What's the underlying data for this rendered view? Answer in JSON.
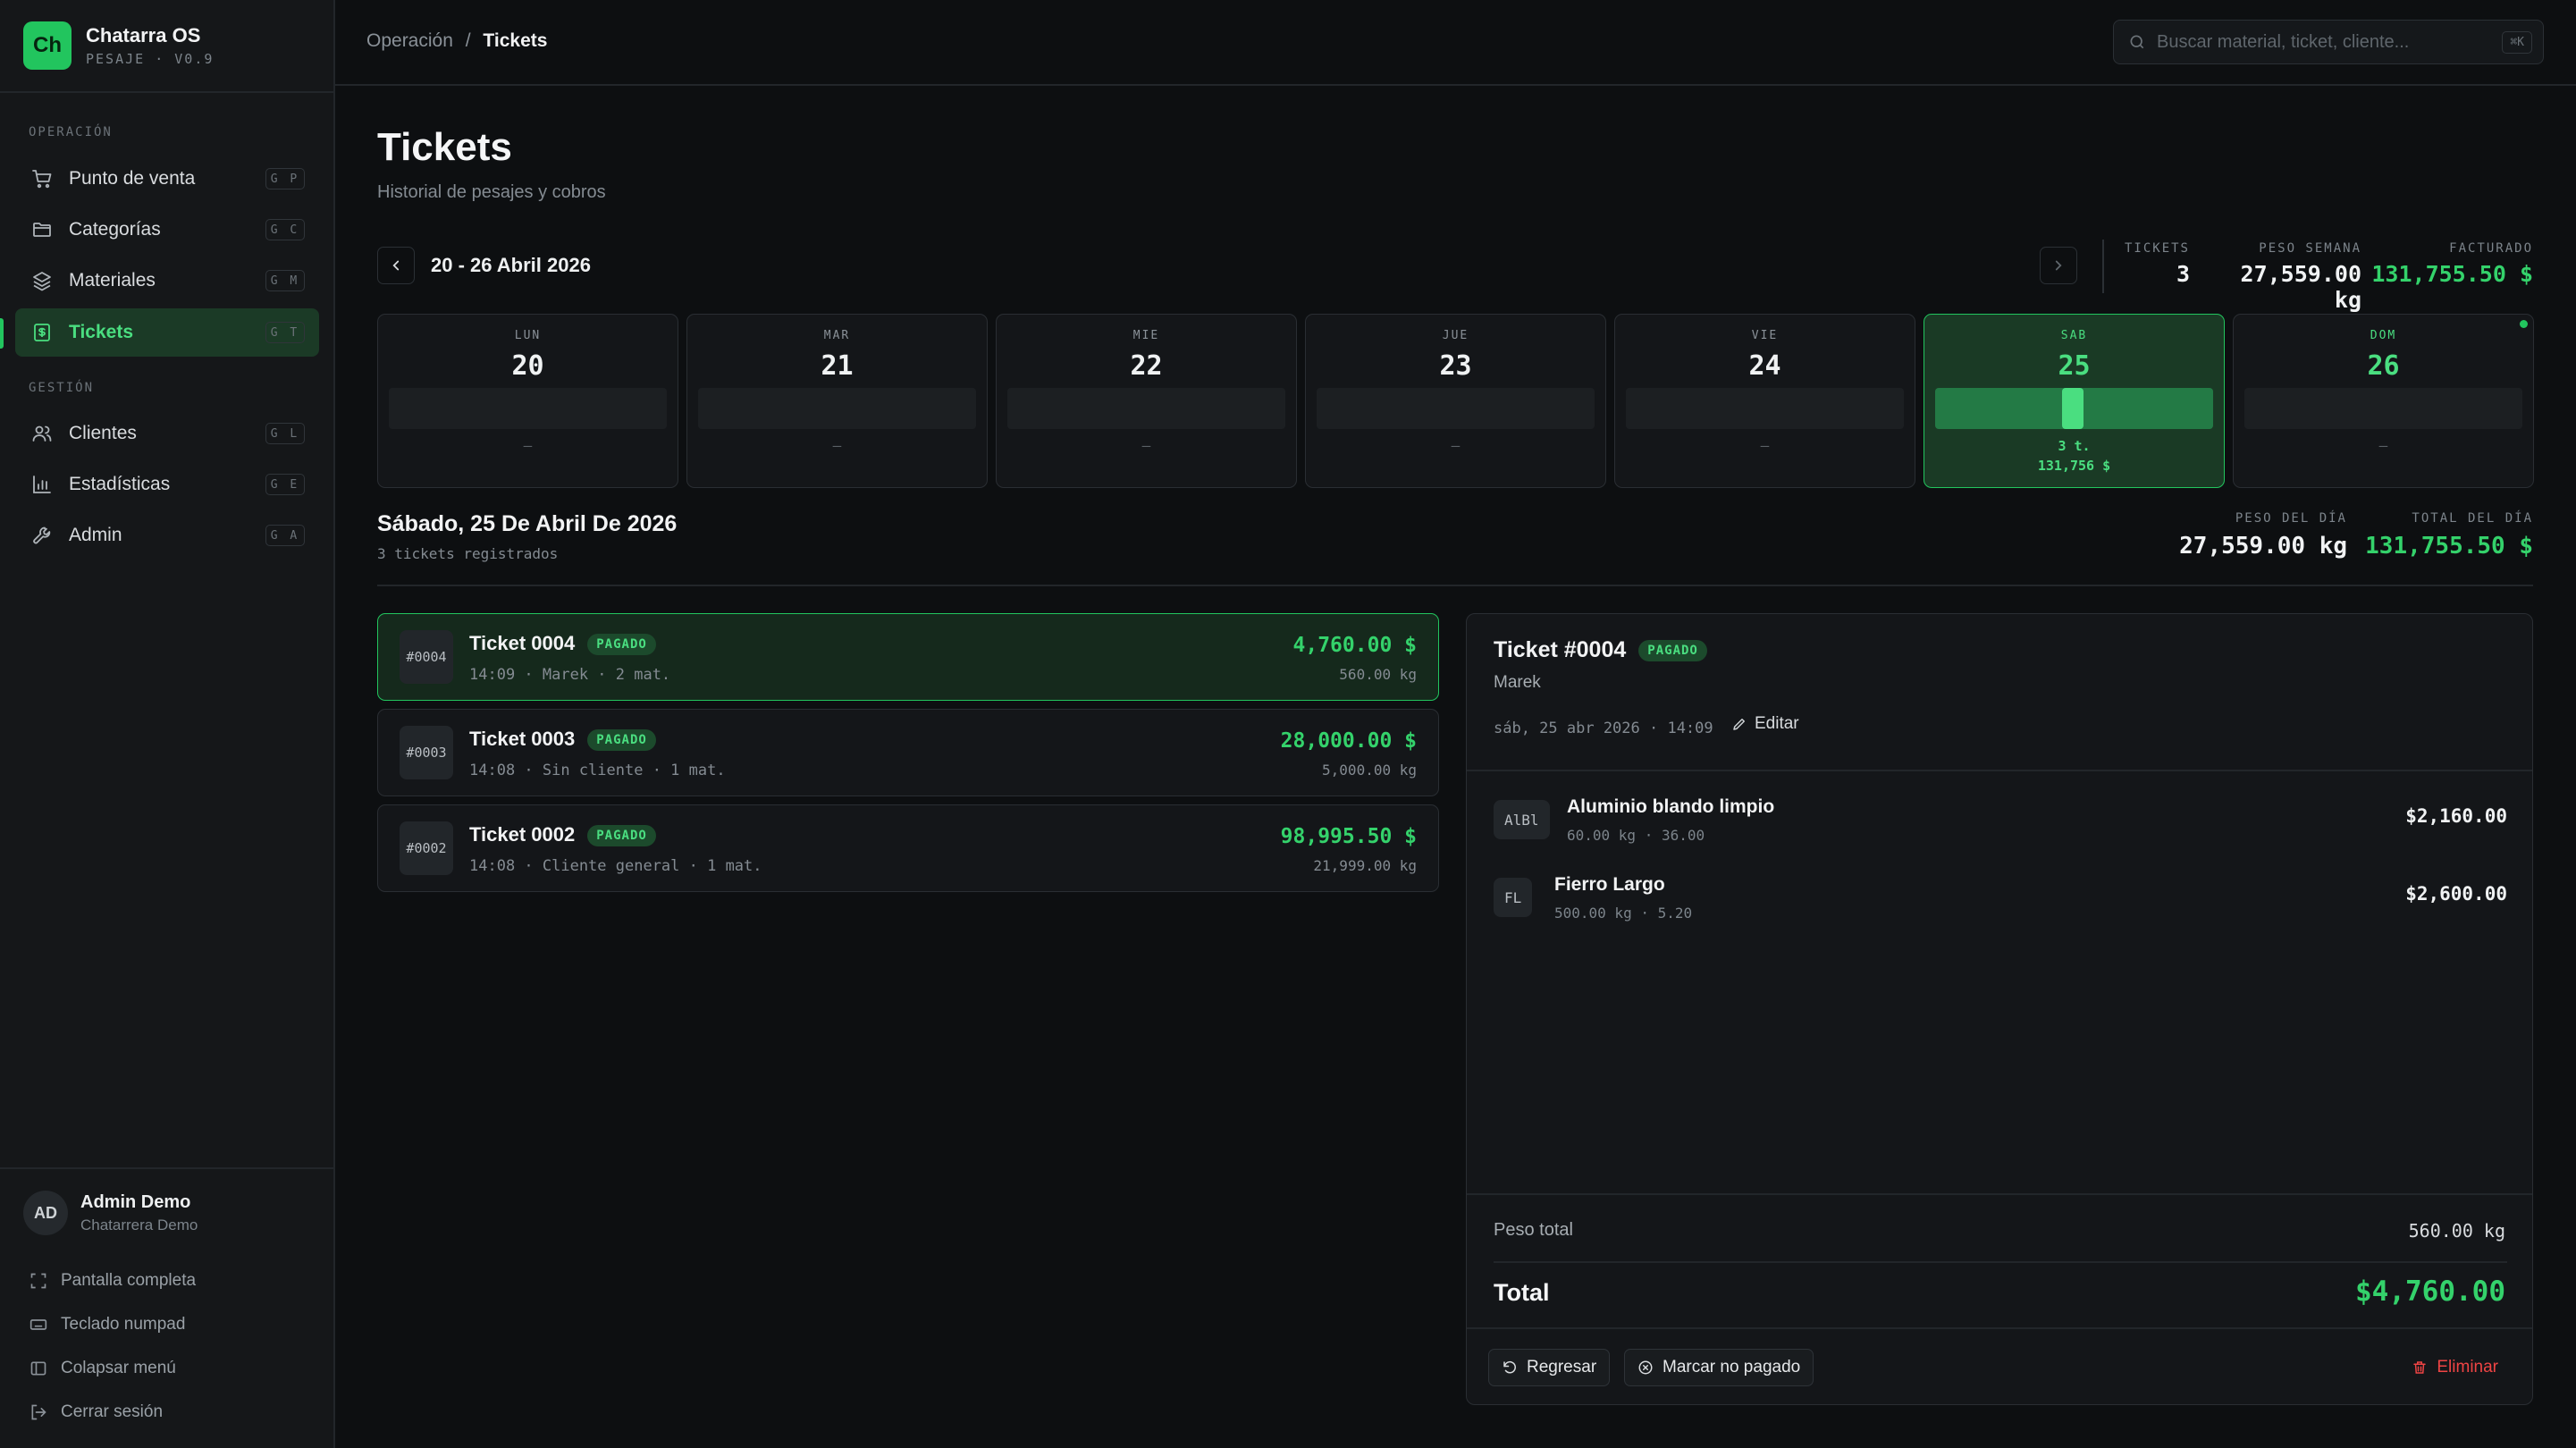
{
  "brand": {
    "initials": "Ch",
    "name": "Chatarra OS",
    "version": "PESAJE · V0.9"
  },
  "sidebar": {
    "section_operacion": "OPERACIÓN",
    "section_gestion": "GESTIÓN",
    "items": [
      {
        "label": "Punto de venta",
        "kbd": "G P",
        "icon": "cart-icon"
      },
      {
        "label": "Categorías",
        "kbd": "G C",
        "icon": "folder-icon"
      },
      {
        "label": "Materiales",
        "kbd": "G M",
        "icon": "layers-icon"
      },
      {
        "label": "Tickets",
        "kbd": "G T",
        "icon": "receipt-icon",
        "active": true
      },
      {
        "label": "Clientes",
        "kbd": "G L",
        "icon": "users-icon"
      },
      {
        "label": "Estadísticas",
        "kbd": "G E",
        "icon": "bar-chart-icon"
      },
      {
        "label": "Admin",
        "kbd": "G A",
        "icon": "wrench-icon"
      }
    ],
    "user": {
      "initials": "AD",
      "name": "Admin Demo",
      "org": "Chatarrera Demo"
    },
    "footer": [
      {
        "label": "Pantalla completa",
        "icon": "fullscreen-icon"
      },
      {
        "label": "Teclado numpad",
        "icon": "keyboard-icon"
      },
      {
        "label": "Colapsar menú",
        "icon": "sidebar-collapse-icon"
      },
      {
        "label": "Cerrar sesión",
        "icon": "logout-icon"
      }
    ]
  },
  "topbar": {
    "breadcrumb": {
      "parent": "Operación",
      "sep": "/",
      "current": "Tickets"
    },
    "search": {
      "placeholder": "Buscar material, ticket, cliente...",
      "shortcut": "⌘K"
    }
  },
  "page": {
    "title": "Tickets",
    "subtitle": "Historial de pesajes y cobros"
  },
  "week": {
    "label": "20 - 26 Abril 2026",
    "stats": {
      "tickets_label": "TICKETS",
      "tickets_value": "3",
      "peso_label": "PESO SEMANA",
      "peso_value": "27,559.00 kg",
      "facturado_label": "FACTURADO",
      "facturado_value": "131,755.50 $"
    },
    "days": [
      {
        "name": "LUN",
        "day": "20",
        "empty": "–"
      },
      {
        "name": "MAR",
        "day": "21",
        "empty": "–"
      },
      {
        "name": "MIE",
        "day": "22",
        "empty": "–"
      },
      {
        "name": "JUE",
        "day": "23",
        "empty": "–"
      },
      {
        "name": "VIE",
        "day": "24",
        "empty": "–"
      },
      {
        "name": "SAB",
        "day": "25",
        "tickets": "3 t.",
        "amount": "131,756 $",
        "selected": true,
        "level": 1.0
      },
      {
        "name": "DOM",
        "day": "26",
        "empty": "–",
        "today": true
      }
    ]
  },
  "day_summary": {
    "title": "Sábado, 25 De Abril De 2026",
    "count": "3 tickets registrados",
    "peso_label": "PESO DEL DÍA",
    "peso_value": "27,559.00 kg",
    "total_label": "TOTAL DEL DÍA",
    "total_value": "131,755.50 $"
  },
  "tickets": [
    {
      "num": "#0004",
      "name": "Ticket 0004",
      "status": "PAGADO",
      "meta": "14:09 · Marek · 2 mat.",
      "amount": "4,760.00 $",
      "kg": "560.00 kg",
      "selected": true
    },
    {
      "num": "#0003",
      "name": "Ticket 0003",
      "status": "PAGADO",
      "meta": "14:08 · Sin cliente · 1 mat.",
      "amount": "28,000.00 $",
      "kg": "5,000.00 kg"
    },
    {
      "num": "#0002",
      "name": "Ticket 0002",
      "status": "PAGADO",
      "meta": "14:08 · Cliente general · 1 mat.",
      "amount": "98,995.50 $",
      "kg": "21,999.00 kg"
    }
  ],
  "detail": {
    "title": "Ticket #0004",
    "status": "PAGADO",
    "client": "Marek",
    "date": "sáb, 25 abr 2026 · 14:09",
    "edit_label": "Editar",
    "items": [
      {
        "code": "AlBl",
        "name": "Aluminio blando limpio",
        "meta": "60.00 kg · 36.00",
        "amount": "$2,160.00"
      },
      {
        "code": "FL",
        "name": "Fierro Largo",
        "meta": "500.00 kg · 5.20",
        "amount": "$2,600.00"
      }
    ],
    "peso_total_label": "Peso total",
    "peso_total_value": "560.00 kg",
    "total_label": "Total",
    "total_value": "$4,760.00",
    "btn_regresar": "Regresar",
    "btn_no_pagado": "Marcar no pagado",
    "btn_eliminar": "Eliminar"
  },
  "colors": {
    "accent": "#22c55e",
    "accent_text": "#4ade80",
    "money": "#34d26b",
    "danger": "#ef4444",
    "bg": "#0d0f11",
    "panel": "#141619"
  }
}
